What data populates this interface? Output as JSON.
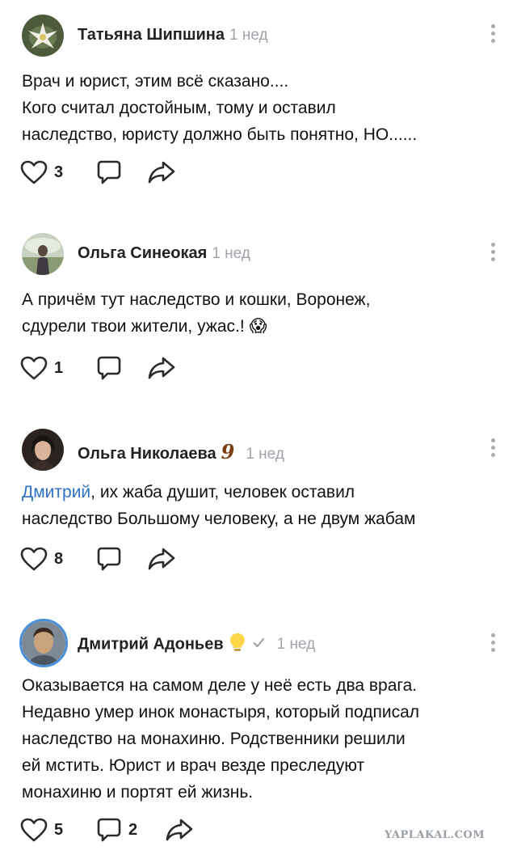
{
  "comments": [
    {
      "author": "Татьяна Шипшина",
      "time": "1 нед",
      "lines": [
        "Врач и юрист, этим всё сказано....",
        "Кого считал достойным, тому и оставил",
        "наследство, юристу должно быть понятно, НО......"
      ],
      "likes": "3",
      "replies": ""
    },
    {
      "author": "Ольга Синеокая",
      "time": "1 нед",
      "lines": [
        "А причём тут наследство и кошки, Воронеж,",
        "сдурели твои жители, ужас.!"
      ],
      "emoji": "😱",
      "likes": "1",
      "replies": ""
    },
    {
      "author": "Ольга Николаева",
      "time": "1 нед",
      "badge": "9",
      "mention": "Дмитрий",
      "lines": [
        ", их жаба душит, человек оставил",
        "наследство Большому человеку, а не двум жабам"
      ],
      "likes": "8",
      "replies": ""
    },
    {
      "author": "Дмитрий Адоньев",
      "time": "1 нед",
      "badge_icon": "lightbulb-icon",
      "verified_icon": "checkmark-icon",
      "lines": [
        "Оказывается на самом деле у неё есть два врага.",
        "Недавно умер инок монастыря, который подписал",
        "наследство на монахиню. Родственники решили",
        "ей мстить. Юрист и врач везде преследуют",
        "монахиню и портят ей жизнь."
      ],
      "likes": "5",
      "replies": "2"
    }
  ],
  "watermark": "YAPLAKAL.COM",
  "colors": {
    "link": "#2c72c7",
    "muted": "#a0a4aa",
    "icon": "#2b2b2b"
  }
}
